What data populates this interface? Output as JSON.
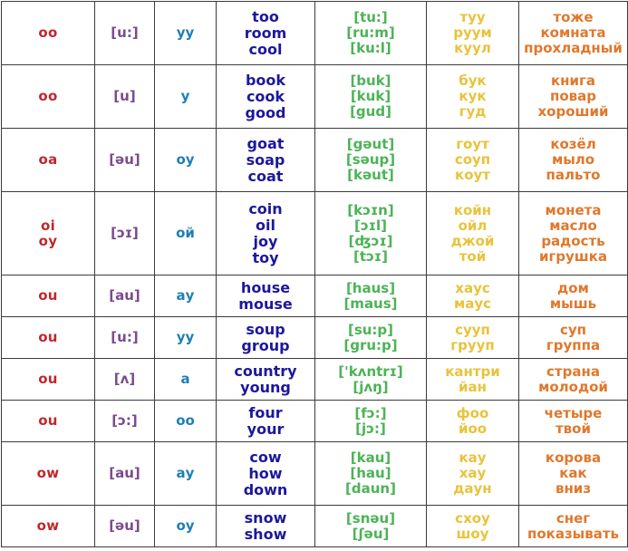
{
  "table": {
    "accent_colors": {
      "grapheme": "#c0272d",
      "ipa": "#7b4a8e",
      "russian_sound": "#1f7fb5",
      "word": "#1c189c",
      "transcription": "#4cb357",
      "transliteration": "#e8c33c",
      "meaning": "#e0782c",
      "border": "#3b3b3b",
      "background": "#ffffff"
    },
    "rows": [
      {
        "grapheme": [
          "oo"
        ],
        "ipa": [
          "[u:]"
        ],
        "russian_sound": [
          "уу"
        ],
        "words": [
          "too",
          "room",
          "cool"
        ],
        "transcriptions": [
          "[tu:]",
          "[ru:m]",
          "[ku:l]"
        ],
        "transliterations": [
          "туу",
          "руум",
          "куул"
        ],
        "meanings": [
          "тоже",
          "комната",
          "прохладный"
        ]
      },
      {
        "grapheme": [
          "oo"
        ],
        "ipa": [
          "[u]"
        ],
        "russian_sound": [
          "у"
        ],
        "words": [
          "book",
          "cook",
          "good"
        ],
        "transcriptions": [
          "[buk]",
          "[kuk]",
          "[gud]"
        ],
        "transliterations": [
          "бук",
          "кук",
          "гуд"
        ],
        "meanings": [
          "книга",
          "повар",
          "хороший"
        ]
      },
      {
        "grapheme": [
          "oa"
        ],
        "ipa": [
          "[əu]"
        ],
        "russian_sound": [
          "оу"
        ],
        "words": [
          "goat",
          "soap",
          "coat"
        ],
        "transcriptions": [
          "[gəut]",
          "[səup]",
          "[kəut]"
        ],
        "transliterations": [
          "гоут",
          "соуп",
          "коут"
        ],
        "meanings": [
          "козёл",
          "мыло",
          "пальто"
        ]
      },
      {
        "grapheme": [
          "oi",
          "oy"
        ],
        "ipa": [
          "[ɔɪ]"
        ],
        "russian_sound": [
          "ой"
        ],
        "words": [
          "coin",
          "oil",
          "joy",
          "toy"
        ],
        "transcriptions": [
          "[kɔɪn]",
          "[ɔɪl]",
          "[ʤɔɪ]",
          "[tɔɪ]"
        ],
        "transliterations": [
          "койн",
          "ойл",
          "джой",
          "той"
        ],
        "meanings": [
          "монета",
          "масло",
          "радость",
          "игрушка"
        ]
      },
      {
        "grapheme": [
          "ou"
        ],
        "ipa": [
          "[au]"
        ],
        "russian_sound": [
          "ау"
        ],
        "words": [
          "house",
          "mouse"
        ],
        "transcriptions": [
          "[haus]",
          "[maus]"
        ],
        "transliterations": [
          "хаус",
          "маус"
        ],
        "meanings": [
          "дом",
          "мышь"
        ]
      },
      {
        "grapheme": [
          "ou"
        ],
        "ipa": [
          "[u:]"
        ],
        "russian_sound": [
          "уу"
        ],
        "words": [
          "soup",
          "group"
        ],
        "transcriptions": [
          "[su:p]",
          "[gru:p]"
        ],
        "transliterations": [
          "сууп",
          "грууп"
        ],
        "meanings": [
          "суп",
          "группа"
        ]
      },
      {
        "grapheme": [
          "ou"
        ],
        "ipa": [
          "[ʌ]"
        ],
        "russian_sound": [
          "а"
        ],
        "words": [
          "country",
          "young"
        ],
        "transcriptions": [
          "['kʌntrɪ]",
          "[jʌŋ]"
        ],
        "transliterations": [
          "кантри",
          "йан"
        ],
        "meanings": [
          "страна",
          "молодой"
        ]
      },
      {
        "grapheme": [
          "ou"
        ],
        "ipa": [
          "[ɔ:]"
        ],
        "russian_sound": [
          "оо"
        ],
        "words": [
          "four",
          "your"
        ],
        "transcriptions": [
          "[fɔ:]",
          "[jɔ:]"
        ],
        "transliterations": [
          "фоо",
          "йоо"
        ],
        "meanings": [
          "четыре",
          "твой"
        ]
      },
      {
        "grapheme": [
          "ow"
        ],
        "ipa": [
          "[au]"
        ],
        "russian_sound": [
          "ау"
        ],
        "words": [
          "cow",
          "how",
          "down"
        ],
        "transcriptions": [
          "[kau]",
          "[hau]",
          "[daun]"
        ],
        "transliterations": [
          "кау",
          "хау",
          "даун"
        ],
        "meanings": [
          "корова",
          "как",
          "вниз"
        ]
      },
      {
        "grapheme": [
          "ow"
        ],
        "ipa": [
          "[əu]"
        ],
        "russian_sound": [
          "оу"
        ],
        "words": [
          "snow",
          "show"
        ],
        "transcriptions": [
          "[snəu]",
          "[ʃəu]"
        ],
        "transliterations": [
          "схоу",
          "шоу"
        ],
        "meanings": [
          "снег",
          "показывать"
        ]
      }
    ]
  }
}
